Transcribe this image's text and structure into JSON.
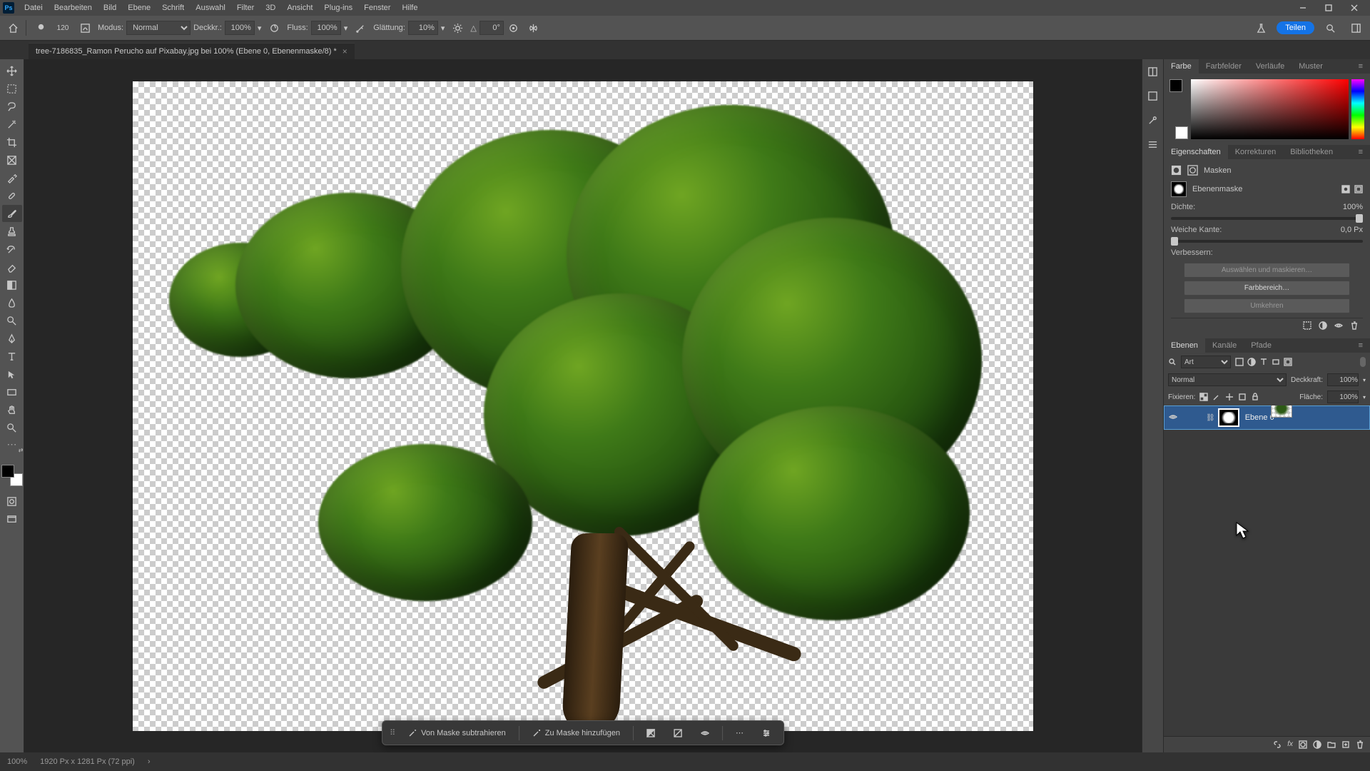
{
  "menu": {
    "items": [
      "Datei",
      "Bearbeiten",
      "Bild",
      "Ebene",
      "Schrift",
      "Auswahl",
      "Filter",
      "3D",
      "Ansicht",
      "Plug-ins",
      "Fenster",
      "Hilfe"
    ]
  },
  "options": {
    "brush_size": "120",
    "mode_label": "Modus:",
    "mode_value": "Normal",
    "opacity_label": "Deckkr.:",
    "opacity_value": "100%",
    "flow_label": "Fluss:",
    "flow_value": "100%",
    "smooth_label": "Glättung:",
    "smooth_value": "10%",
    "angle_value": "0°",
    "share_label": "Teilen"
  },
  "document": {
    "tab_title": "tree-7186835_Ramon Perucho auf Pixabay.jpg bei 100% (Ebene 0, Ebenenmaske/8) *"
  },
  "panels": {
    "color_tabs": [
      "Farbe",
      "Farbfelder",
      "Verläufe",
      "Muster"
    ],
    "props_tabs": [
      "Eigenschaften",
      "Korrekturen",
      "Bibliotheken"
    ],
    "props": {
      "masks_label": "Masken",
      "mask_type": "Ebenenmaske",
      "density_label": "Dichte:",
      "density_value": "100%",
      "feather_label": "Weiche Kante:",
      "feather_value": "0,0 Px",
      "refine_label": "Verbessern:",
      "select_mask_btn": "Auswählen und maskieren…",
      "color_range_btn": "Farbbereich…",
      "invert_btn": "Umkehren"
    },
    "layers_tabs": [
      "Ebenen",
      "Kanäle",
      "Pfade"
    ],
    "layers": {
      "filter_kind": "Art",
      "blend_mode": "Normal",
      "opacity_label": "Deckkraft:",
      "opacity_value": "100%",
      "lock_label": "Fixieren:",
      "fill_label": "Fläche:",
      "fill_value": "100%",
      "layer0_name": "Ebene 0"
    }
  },
  "ctxbar": {
    "subtract": "Von Maske subtrahieren",
    "add": "Zu Maske hinzufügen"
  },
  "status": {
    "zoom": "100%",
    "docinfo": "1920 Px x 1281 Px (72 ppi)"
  }
}
